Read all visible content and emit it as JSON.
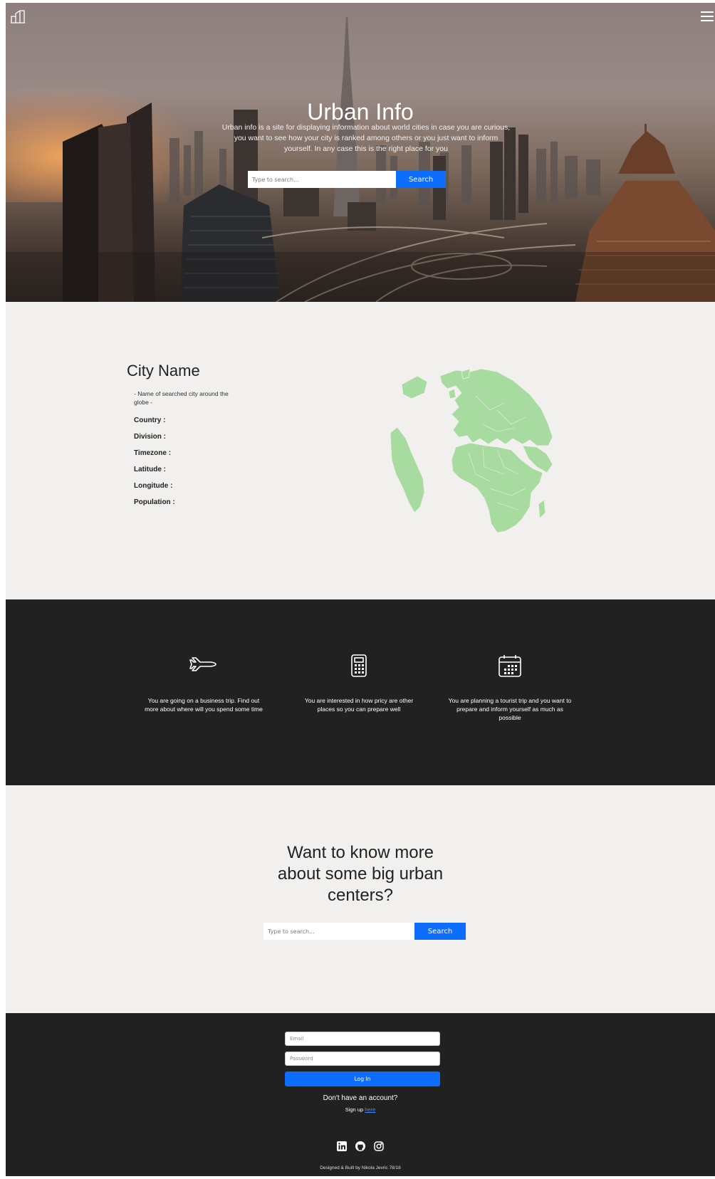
{
  "header": {
    "logo_icon": "building-icon",
    "menu_icon": "hamburger-menu-icon",
    "title": "Urban Info",
    "description": "Urban info is a site for displaying information about world cities in case you are curious, you want to see how your city is ranked among others or you just want to inform yourself. In any case this is the right place for you",
    "search": {
      "placeholder": "Type to search...",
      "button_label": "Search"
    }
  },
  "city": {
    "name": "City Name",
    "subtitle": "- Name of searched city around the globe -",
    "fields": [
      "Country :",
      "Division :",
      "Timezone :",
      "Latitude :",
      "Longitude :",
      "Population :"
    ],
    "globe_icon": "globe-map-icon"
  },
  "features": [
    {
      "icon": "airplane-icon",
      "text": "You are going on a business trip. Find out more about where will you spend some time"
    },
    {
      "icon": "calculator-icon",
      "text": "You are interested in how pricy are other places so you can prepare well"
    },
    {
      "icon": "calendar-icon",
      "text": "You are planning a tourist trip and you want to prepare and inform yourself as much as possible"
    }
  ],
  "cta": {
    "title": "Want to know more about some big urban centers?",
    "search": {
      "placeholder": "Type to search...",
      "button_label": "Search"
    }
  },
  "footer": {
    "email_placeholder": "Email",
    "password_placeholder": "Password",
    "login_label": "Log In",
    "no_account": "Don't have an account?",
    "signup_prefix": "Sign up",
    "signup_link": "here",
    "socials": [
      "linkedin-icon",
      "github-icon",
      "instagram-icon"
    ],
    "credit": "Designed & Built by Nikola Jevric 78/18"
  },
  "colors": {
    "accent": "#0d6efd",
    "dark": "#212121",
    "light": "#f1f0ee",
    "globe": "#a8dba0"
  }
}
